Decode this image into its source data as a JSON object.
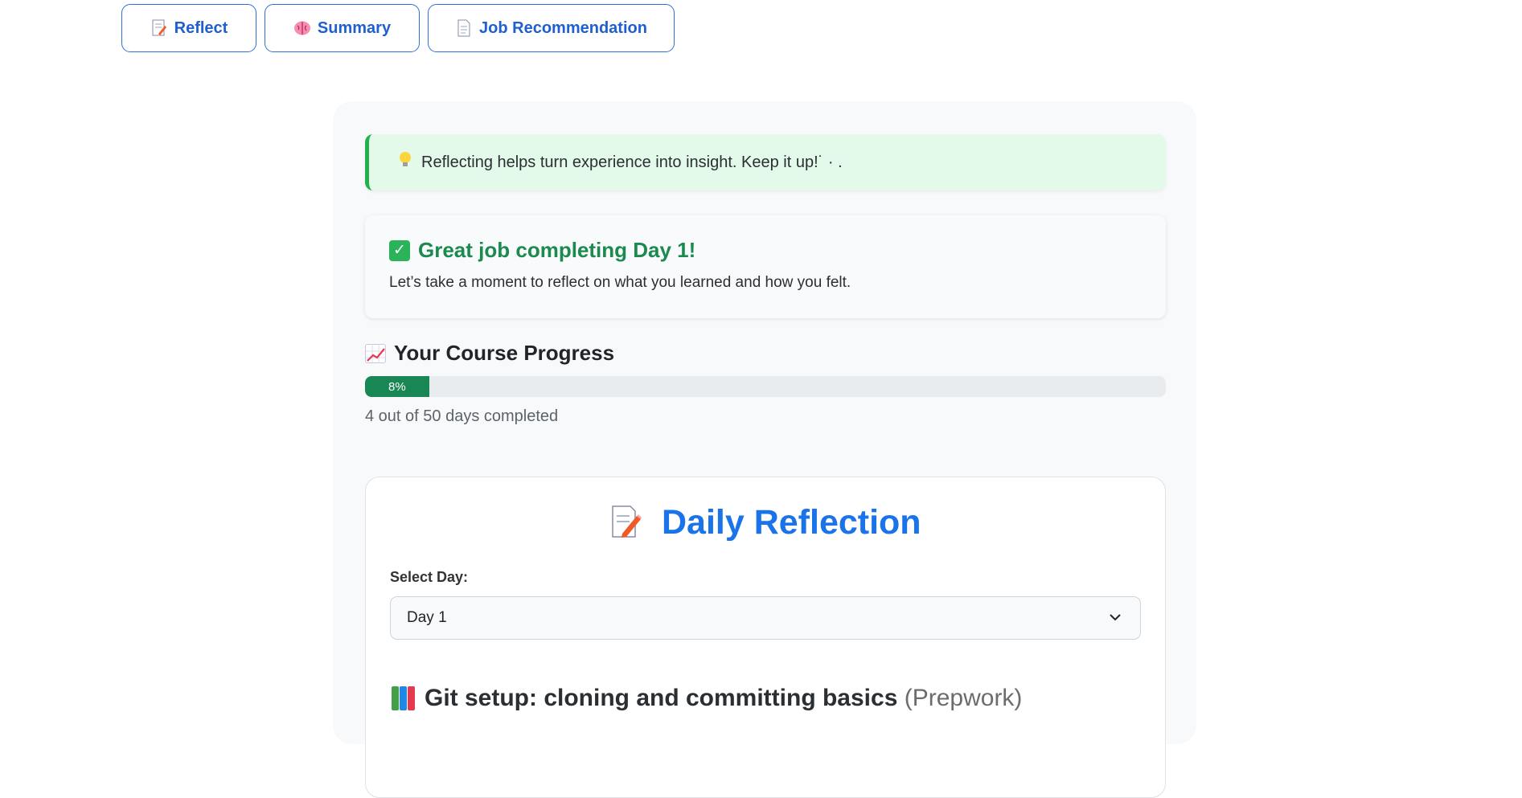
{
  "tabs": [
    {
      "label": "Reflect",
      "icon": "memo-icon"
    },
    {
      "label": "Summary",
      "icon": "brain-icon"
    },
    {
      "label": "Job Recommendation",
      "icon": "page-icon"
    }
  ],
  "tip": {
    "text": "Reflecting helps turn experience into insight. Keep it up!˙ · ."
  },
  "greeting": {
    "title": "Great job completing Day 1!",
    "subtitle": "Let’s take a moment to reflect on what you learned and how you felt."
  },
  "progress": {
    "title": "Your Course Progress",
    "percent_label": "8%",
    "fraction": 0.08,
    "status": "4 out of 50 days completed"
  },
  "reflection": {
    "title": "Daily Reflection",
    "select_label": "Select Day:",
    "selected_day": "Day 1",
    "topic": "Git setup: cloning and committing basics",
    "topic_tag": "(Prepwork)"
  },
  "colors": {
    "accent": "#1a73e8",
    "success": "#198754",
    "tip_background": "#e3faea",
    "tip_border": "#22b14c"
  }
}
